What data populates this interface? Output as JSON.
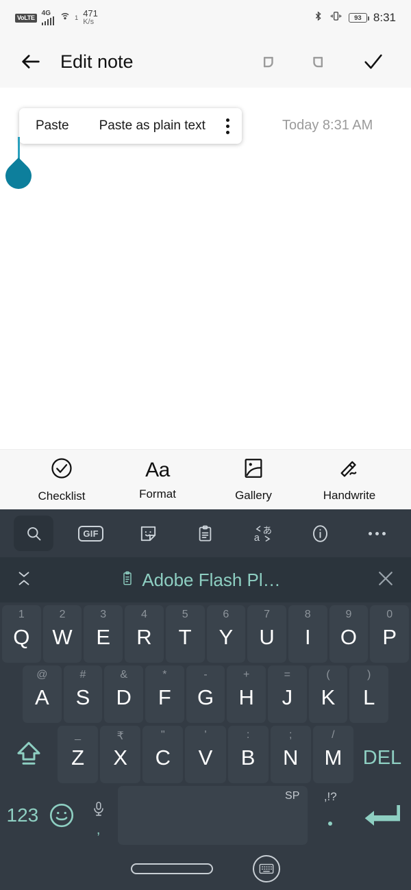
{
  "statusbar": {
    "volte": "VoLTE",
    "network_type": "4G",
    "hotspot_count": "1",
    "speed_value": "471",
    "speed_unit": "K/s",
    "bluetooth_icon": "bluetooth-icon",
    "vibrate_icon": "vibrate-icon",
    "battery_percent": "93",
    "time": "8:31"
  },
  "appbar": {
    "back_icon": "back-arrow-icon",
    "title": "Edit note",
    "undo_icon": "undo-icon",
    "redo_icon": "redo-icon",
    "done_icon": "checkmark-icon"
  },
  "note": {
    "paste_menu": {
      "paste_label": "Paste",
      "paste_plain_label": "Paste as plain text",
      "overflow_icon": "more-vertical-icon"
    },
    "timestamp": "Today 8:31 AM",
    "body_text": "",
    "cursor_handle_icon": "text-cursor-handle-icon",
    "cursor_color": "#0d7f9c"
  },
  "format_toolbar": {
    "items": [
      {
        "label": "Checklist",
        "icon": "check-circle-icon"
      },
      {
        "label": "Format",
        "icon": "text-format-icon"
      },
      {
        "label": "Gallery",
        "icon": "image-icon"
      },
      {
        "label": "Handwrite",
        "icon": "pen-icon"
      }
    ]
  },
  "keyboard": {
    "toolbar": [
      {
        "name": "search-icon",
        "active": true
      },
      {
        "name": "gif-icon",
        "label": "GIF",
        "active": false
      },
      {
        "name": "sticker-icon",
        "active": false
      },
      {
        "name": "clipboard-icon",
        "active": false
      },
      {
        "name": "translate-icon",
        "active": false
      },
      {
        "name": "info-icon",
        "active": false
      },
      {
        "name": "more-icon",
        "active": false
      }
    ],
    "clipboard_bar": {
      "collapse_icon": "collapse-chevrons-icon",
      "clip_icon": "clipboard-icon",
      "suggestion": "Adobe Flash Pl…",
      "close_icon": "close-icon",
      "accent_color": "#8ecfc2"
    },
    "row1": [
      {
        "main": "Q",
        "hint": "1"
      },
      {
        "main": "W",
        "hint": "2"
      },
      {
        "main": "E",
        "hint": "3"
      },
      {
        "main": "R",
        "hint": "4"
      },
      {
        "main": "T",
        "hint": "5"
      },
      {
        "main": "Y",
        "hint": "6"
      },
      {
        "main": "U",
        "hint": "7"
      },
      {
        "main": "I",
        "hint": "8"
      },
      {
        "main": "O",
        "hint": "9"
      },
      {
        "main": "P",
        "hint": "0"
      }
    ],
    "row2": [
      {
        "main": "A",
        "hint": "@"
      },
      {
        "main": "S",
        "hint": "#"
      },
      {
        "main": "D",
        "hint": "&"
      },
      {
        "main": "F",
        "hint": "*"
      },
      {
        "main": "G",
        "hint": "-"
      },
      {
        "main": "H",
        "hint": "+"
      },
      {
        "main": "J",
        "hint": "="
      },
      {
        "main": "K",
        "hint": "("
      },
      {
        "main": "L",
        "hint": ")"
      }
    ],
    "row3": {
      "shift_icon": "shift-caps-icon",
      "keys": [
        {
          "main": "Z",
          "hint": "_"
        },
        {
          "main": "X",
          "hint": "₹"
        },
        {
          "main": "C",
          "hint": "\""
        },
        {
          "main": "V",
          "hint": "'"
        },
        {
          "main": "B",
          "hint": ":"
        },
        {
          "main": "N",
          "hint": ";"
        },
        {
          "main": "M",
          "hint": "/"
        }
      ],
      "delete_label": "DEL"
    },
    "row4": {
      "numeric_label": "123",
      "emoji_icon": "emoji-smiley-icon",
      "mic_icon": "microphone-icon",
      "mic_hint": ",",
      "space_hint": "SP",
      "period_hint": ",!?",
      "period_main": ".",
      "enter_icon": "enter-return-icon"
    },
    "accent_color": "#8ecfc2",
    "background_color": "#333b44"
  },
  "navbar": {
    "home_indicator": "home-pill-indicator",
    "hide_keyboard_icon": "hide-keyboard-icon"
  }
}
